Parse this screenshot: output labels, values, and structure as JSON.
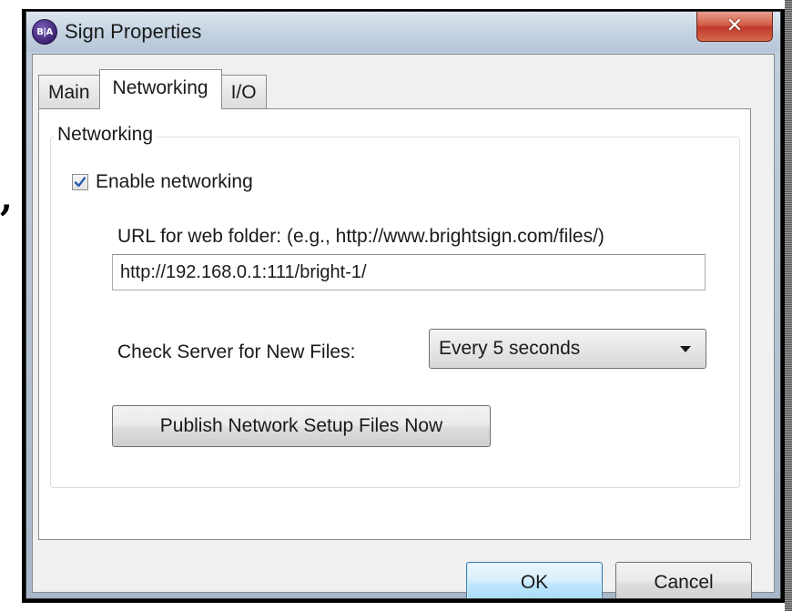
{
  "stray_glyph": ",",
  "window": {
    "title": "Sign Properties",
    "app_icon_text": "B|A",
    "close_glyph": "✕"
  },
  "tabs": [
    {
      "label": "Main",
      "active": false
    },
    {
      "label": "Networking",
      "active": true
    },
    {
      "label": "I/O",
      "active": false
    }
  ],
  "networking": {
    "group_title": "Networking",
    "enable_label": "Enable networking",
    "enable_checked": true,
    "url_label": "URL for web folder: (e.g., http://www.brightsign.com/files/)",
    "url_value": "http://192.168.0.1:111/bright-1/",
    "check_server_label": "Check Server for New Files:",
    "check_server_value": "Every 5 seconds",
    "publish_button": "Publish Network Setup Files Now"
  },
  "footer": {
    "ok_label": "OK",
    "cancel_label": "Cancel"
  },
  "colors": {
    "ok_accent": "#3c7fb1",
    "close_red": "#c0392b",
    "checkmark": "#2a5db0"
  },
  "icons": {
    "app": "brightauthor-logo-icon",
    "close": "close-icon",
    "dropdown": "chevron-down-icon",
    "check": "checkmark-icon"
  }
}
